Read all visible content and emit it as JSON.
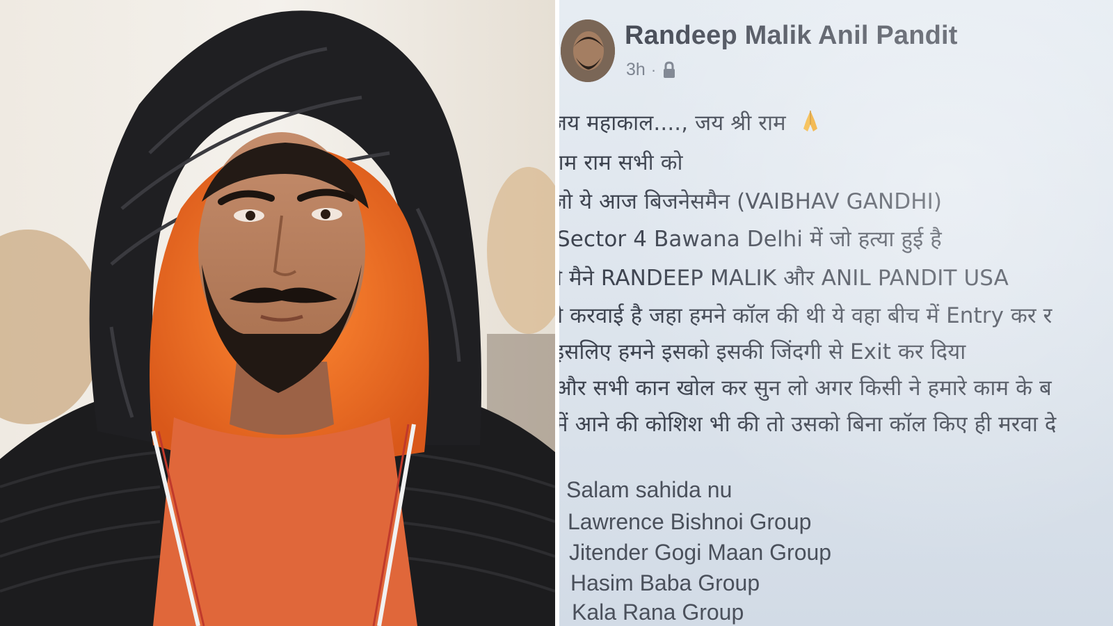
{
  "post": {
    "author_name": "Randeep Malik Anil Pandit",
    "timestamp": "3h",
    "separator": "·",
    "audience_icon": "lock-icon",
    "lines": [
      "जय महाकाल...., जय श्री राम",
      "राम राम सभी को",
      "जो ये आज बिजनेसमैन (VAIBHAV GANDHI)",
      "Sector 4 Bawana Delhi में जो हत्या हुई है",
      "ये मैने RANDEEP MALIK और ANIL PANDIT USA",
      "ने करवाई है जहा हमने कॉल की थी ये वहा बीच में Entry कर र",
      "इसलिए हमने इसको इसकी जिंदगी से Exit कर दिया",
      "और सभी कान खोल कर सुन लो अगर किसी ने हमारे काम के ब",
      "में आने की कोशिश भी की तो उसको बिना कॉल किए ही मरवा दे"
    ],
    "emoji_icon": "folded-hands-icon",
    "signoff": [
      "Salam sahida nu",
      "Lawrence Bishnoi Group",
      "Jitender Gogi Maan Group",
      "Hasim Baba Group",
      "Kala Rana Group"
    ]
  },
  "photo": {
    "subject": "man in black hooded puffer jacket with orange lining"
  },
  "colors": {
    "post_background": "#dfe6ee",
    "text": "#3e4450",
    "author_name": "#4a4f5a",
    "jacket": "#1c1c1e",
    "hood_lining": "#f07a2a",
    "shirt": "#e0673a"
  }
}
